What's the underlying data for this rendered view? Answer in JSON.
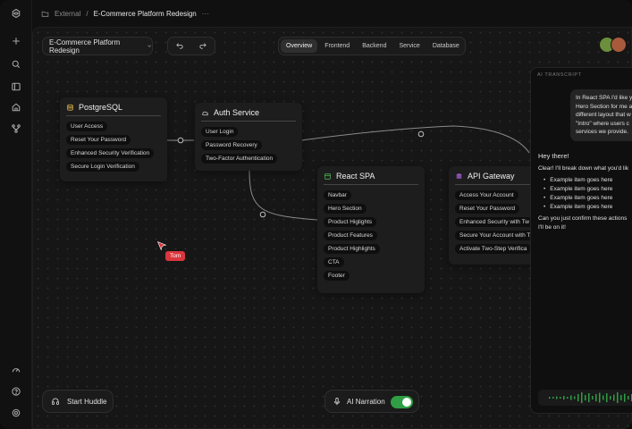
{
  "breadcrumb": {
    "parent": "External",
    "separator": "/",
    "current": "E-Commerce Platform Redesign",
    "more": "···"
  },
  "toolbar": {
    "project_selector": "E-Commerce Platform Redesign"
  },
  "tabs": [
    {
      "label": "Overview",
      "active": true
    },
    {
      "label": "Frontend",
      "active": false
    },
    {
      "label": "Backend",
      "active": false
    },
    {
      "label": "Service",
      "active": false
    },
    {
      "label": "Database",
      "active": false
    }
  ],
  "nodes": {
    "postgres": {
      "title": "PostgreSQL",
      "icon": "database-icon",
      "items": [
        "User Access",
        "Reset Your Password",
        "Enhanced Security Verification",
        "Secure Login Verification"
      ]
    },
    "auth": {
      "title": "Auth Service",
      "icon": "cloud-icon",
      "items": [
        "User Login",
        "Password Recovery",
        "Two-Factor Authentication"
      ]
    },
    "react": {
      "title": "React SPA",
      "icon": "window-icon",
      "items": [
        "Navbar",
        "Hero Section",
        "Product Higlights",
        "Product Features",
        "Product Highlights",
        "CTA",
        "Footer"
      ]
    },
    "gateway": {
      "title": "API Gateway",
      "icon": "stack-icon",
      "items": [
        "Access Your Account",
        "Reset Your Password",
        "Enhanced Security with Tw",
        "Secure Your Account with T",
        "Activate Two-Step Verifica"
      ]
    }
  },
  "transcript": {
    "title": "AI TRANSCRIPT",
    "user_lines": [
      "In React SPA I'd like y",
      "Hero Section for me a",
      "different layout that w",
      "\"Intro\" where users c",
      "services we provide."
    ],
    "greeting": "Hey there!",
    "intro": "Clear! I'll break down what you'd lik",
    "bullets": [
      "Example item goes here",
      "Example item goes here",
      "Example item goes here",
      "Example item goes here"
    ],
    "outro_lines": [
      "Can you just confirm these actions",
      "I'll be on it!"
    ]
  },
  "cursor_label": "Tom",
  "controls": {
    "huddle_label": "Start Huddle",
    "narration_label": "AI Narration",
    "narration_on": true
  },
  "colors": {
    "accent_green": "#2f9e44",
    "cursor_red": "#d9363e",
    "gateway_purple": "#b06ad9",
    "react_green": "#4caf50",
    "postgres_yellow": "#e0b84a"
  }
}
